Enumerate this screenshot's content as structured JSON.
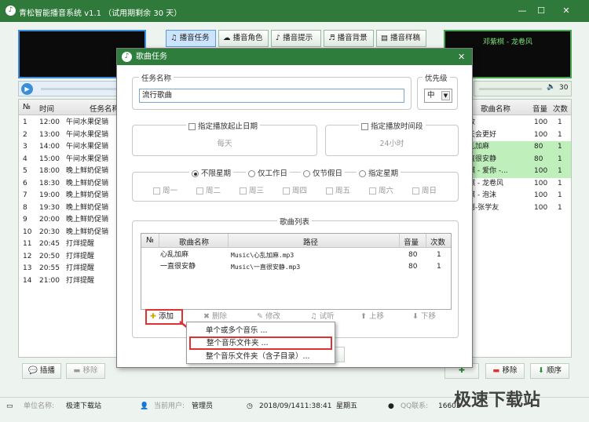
{
  "app": {
    "title": "青松智能播音系统 v1.1  （试用期剩余 30 天）",
    "min": "—",
    "max": "☐",
    "close": "✕"
  },
  "tabs": [
    "播音任务",
    "播音角色",
    "播音提示",
    "播音背景",
    "播音样稿"
  ],
  "right_display": "邓紫棋 - 龙卷风",
  "volume_right": "30",
  "left_table": {
    "headers": [
      "№",
      "时间",
      "任务名称"
    ],
    "rows": [
      [
        "1",
        "12:00",
        "午间水果促销"
      ],
      [
        "2",
        "13:00",
        "午间水果促销"
      ],
      [
        "3",
        "14:00",
        "午间水果促销"
      ],
      [
        "4",
        "15:00",
        "午间水果促销"
      ],
      [
        "5",
        "18:00",
        "晚上鲜奶促销"
      ],
      [
        "6",
        "18:30",
        "晚上鲜奶促销"
      ],
      [
        "7",
        "19:00",
        "晚上鲜奶促销"
      ],
      [
        "8",
        "19:30",
        "晚上鲜奶促销"
      ],
      [
        "9",
        "20:00",
        "晚上鲜奶促销"
      ],
      [
        "10",
        "20:30",
        "晚上鲜奶促销"
      ],
      [
        "11",
        "20:45",
        "打烊提醒"
      ],
      [
        "12",
        "20:50",
        "打烊提醒"
      ],
      [
        "13",
        "20:55",
        "打烊提醒"
      ],
      [
        "14",
        "21:00",
        "打烊提醒"
      ]
    ]
  },
  "right_table": {
    "headers": [
      "歌曲名称",
      "音量",
      "次数"
    ],
    "rows": [
      [
        "敢",
        "100",
        "1"
      ],
      [
        "天会更好",
        "100",
        "1"
      ],
      [
        "乱加麻",
        "80",
        "1"
      ],
      [
        "直很安静",
        "80",
        "1"
      ],
      [
        "棋 - 爱你 -...",
        "100",
        "1"
      ],
      [
        "棋 - 龙卷风",
        "100",
        "1"
      ],
      [
        "棋 - 泡沫",
        "100",
        "1"
      ],
      [
        "则-张学友",
        "100",
        "1"
      ]
    ]
  },
  "left_buttons": {
    "insert": "插播",
    "remove": "移除"
  },
  "right_buttons": {
    "remove": "移除",
    "order": "顺序"
  },
  "status": {
    "unit_label": "单位名称:",
    "unit_value": "极速下载站",
    "user_label": "当前用户:",
    "user_value": "管理员",
    "date": "2018/09/14",
    "time": "11:38:41",
    "weekday": "星期五",
    "qq_label": "QQ联系:",
    "qq_value": "16603"
  },
  "watermark": "极速下载站",
  "dialog": {
    "title": "歌曲任务",
    "task_name_label": "任务名称",
    "task_name_value": "流行歌曲",
    "priority_label": "优先级",
    "priority_value": "中",
    "date_range_label": "指定播放起止日期",
    "date_range_value": "每天",
    "time_range_label": "指定播放时间段",
    "time_range_value": "24小时",
    "week_options": [
      "不限星期",
      "仅工作日",
      "仅节假日",
      "指定星期"
    ],
    "weekdays": [
      "周一",
      "周二",
      "周三",
      "周四",
      "周五",
      "周六",
      "周日"
    ],
    "song_list_label": "歌曲列表",
    "song_headers": [
      "№",
      "歌曲名称",
      "路径",
      "音量",
      "次数"
    ],
    "songs": [
      [
        "",
        "心乱加麻",
        "Music\\心乱加麻.mp3",
        "80",
        "1"
      ],
      [
        "",
        "一直很安静",
        "Music\\一直很安静.mp3",
        "80",
        "1"
      ]
    ],
    "toolbar": {
      "add": "添加",
      "delete": "删除",
      "edit": "修改",
      "audition": "试听",
      "up": "上移",
      "down": "下移"
    }
  },
  "add_menu": [
    "单个或多个音乐 ...",
    "整个音乐文件夹 ...",
    "整个音乐文件夹（含子目录）..."
  ]
}
